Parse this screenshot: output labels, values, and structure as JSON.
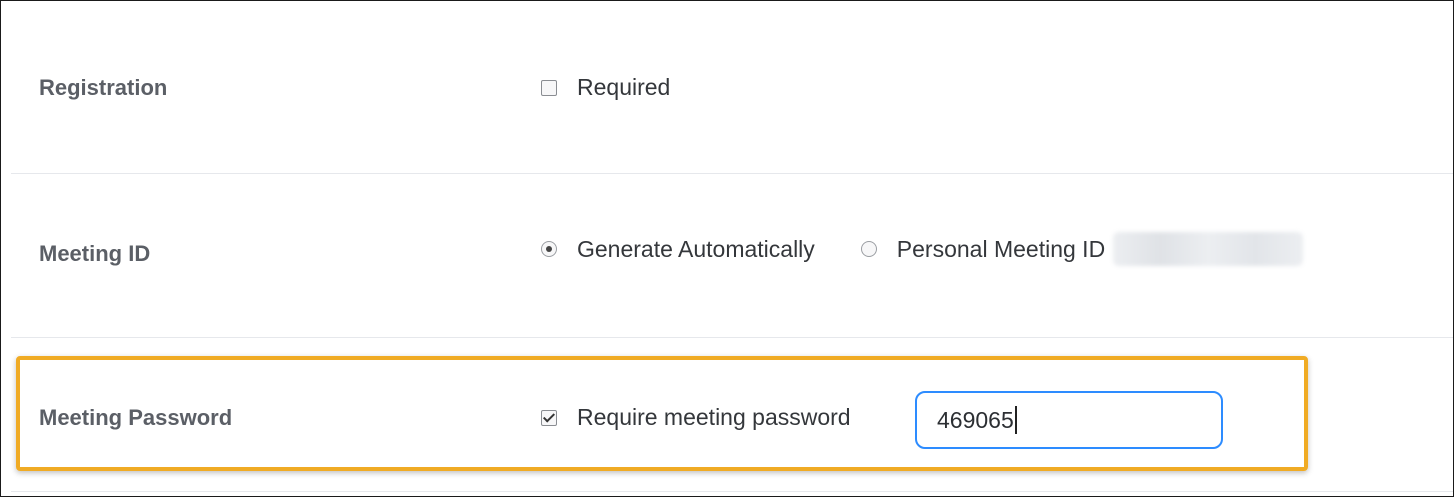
{
  "settings": {
    "registration": {
      "label": "Registration",
      "option_label": "Required",
      "checked": false
    },
    "meeting_id": {
      "label": "Meeting ID",
      "options": [
        {
          "label": "Generate Automatically",
          "selected": true
        },
        {
          "label": "Personal Meeting ID",
          "selected": false
        }
      ]
    },
    "meeting_password": {
      "label": "Meeting Password",
      "option_label": "Require meeting password",
      "checked": true,
      "value": "469065"
    }
  },
  "colors": {
    "highlight": "#f0ab24",
    "input_focus": "#2d8cff",
    "label_text": "#5b5f66",
    "divider": "#e6e8ec"
  }
}
